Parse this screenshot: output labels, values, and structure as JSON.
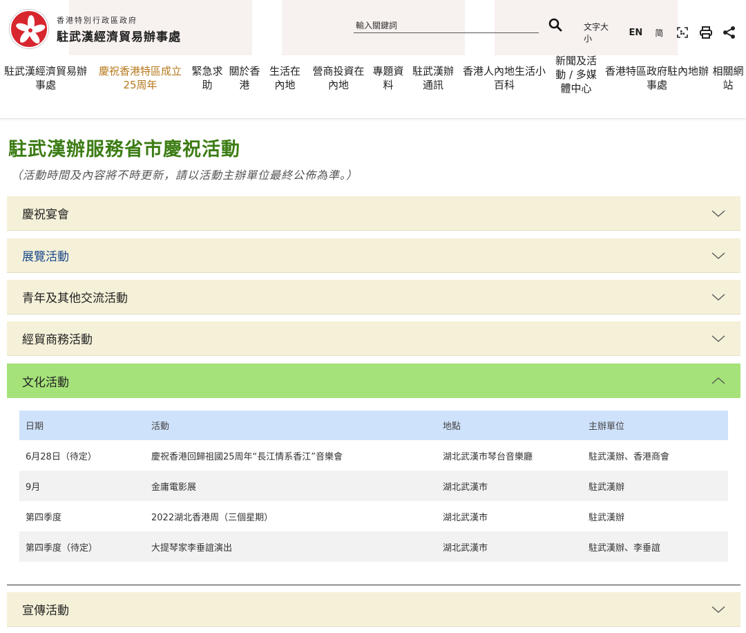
{
  "header": {
    "org_line1": "香港特別行政區政府",
    "org_line2": "駐武漢經濟貿易辦事處",
    "search_placeholder": "輸入關鍵詞",
    "font_size_label": "文字大小",
    "lang_en": "EN",
    "lang_sc": "简",
    "icons": [
      "search-icon",
      "qr-code-icon",
      "print-icon",
      "share-icon"
    ]
  },
  "nav": {
    "items": [
      {
        "label": "駐武漢經濟貿易辦事處",
        "active": false
      },
      {
        "label": "慶祝香港特區成立25周年",
        "active": true
      },
      {
        "label": "緊急求助",
        "active": false
      },
      {
        "label": "關於香港",
        "active": false
      },
      {
        "label": "生活在內地",
        "active": false
      },
      {
        "label": "營商投資在內地",
        "active": false
      },
      {
        "label": "專題資料",
        "active": false
      },
      {
        "label": "駐武漢辦通訊",
        "active": false
      },
      {
        "label": "香港人內地生活小百科",
        "active": false
      },
      {
        "label": "新聞及活動 / 多媒體中心",
        "active": false
      },
      {
        "label": "香港特區政府駐內地辦事處",
        "active": false
      },
      {
        "label": "相關網站",
        "active": false
      }
    ]
  },
  "main": {
    "title": "駐武漢辦服務省市慶祝活動",
    "note": "（活動時間及內容將不時更新，請以活動主辦單位最終公佈為準。）",
    "sections": [
      {
        "label": "慶祝宴會",
        "open": false
      },
      {
        "label": "展覽活動",
        "open": false
      },
      {
        "label": "青年及其他交流活動",
        "open": false
      },
      {
        "label": "經貿商務活動",
        "open": false
      },
      {
        "label": "文化活動",
        "open": true
      },
      {
        "label": "宣傳活動",
        "open": false
      }
    ],
    "table": {
      "headers": [
        "日期",
        "活動",
        "地點",
        "主辦單位"
      ],
      "rows": [
        [
          "6月28日（待定）",
          "慶祝香港回歸祖國25周年“長江情系香江”音樂會",
          "湖北武漢市琴台音樂廳",
          "駐武漢辦、香港商會"
        ],
        [
          "9月",
          "金庸電影展",
          "湖北武漢市",
          "駐武漢辦"
        ],
        [
          "第四季度",
          "2022湖北香港周（三個星期）",
          "湖北武漢市",
          "駐武漢辦"
        ],
        [
          "第四季度（待定）",
          "大提琴家李垂誼演出",
          "湖北武漢市",
          "駐武漢辦、李垂誼"
        ]
      ]
    }
  },
  "colors": {
    "title_green": "#3c7c14",
    "active_nav": "#b6781c",
    "accordion_bg": "#f5f0d8",
    "accordion_open_bg": "#a5e279",
    "table_header_bg": "#cfe2fb"
  }
}
